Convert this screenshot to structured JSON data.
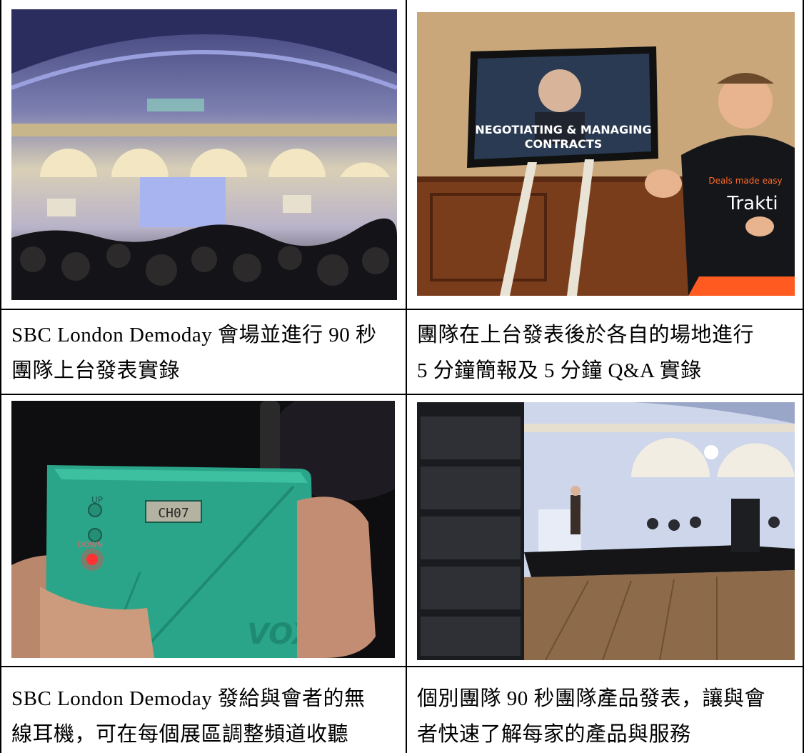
{
  "rows": [
    {
      "left": {
        "photo": "conference-hall-photo",
        "caption_line1": "SBC London Demoday 會場並進行 90 秒",
        "caption_line2": "團隊上台發表實錄"
      },
      "right": {
        "photo": "presenter-with-screen-photo",
        "screen_text_line1": "NEGOTIATING & MANAGING",
        "screen_text_line2": "CONTRACTS",
        "shirt_slogan": "Deals made easy",
        "shirt_brand": "Trakti",
        "caption_line1": "團隊在上台發表後於各自的場地進行",
        "caption_line2": "5 分鐘簡報及 5 分鐘 Q&A 實錄"
      }
    },
    {
      "left": {
        "photo": "wireless-receiver-photo",
        "device_up_label": "UP",
        "device_down_label": "DOWN",
        "device_display": "CH07",
        "device_brand": "VOX",
        "caption_line1": "SBC London Demoday 發給與會者的無",
        "caption_line2": "線耳機，可在每個展區調整頻道收聽"
      },
      "right": {
        "photo": "stage-and-speakers-photo",
        "caption_line1": "個別團隊 90 秒團隊產品發表，讓與會",
        "caption_line2": "者快速了解每家的產品與服務"
      }
    }
  ],
  "colors": {
    "border": "#000000",
    "device_teal": "#2aa58a",
    "trakti_orange": "#ff5a1f"
  }
}
